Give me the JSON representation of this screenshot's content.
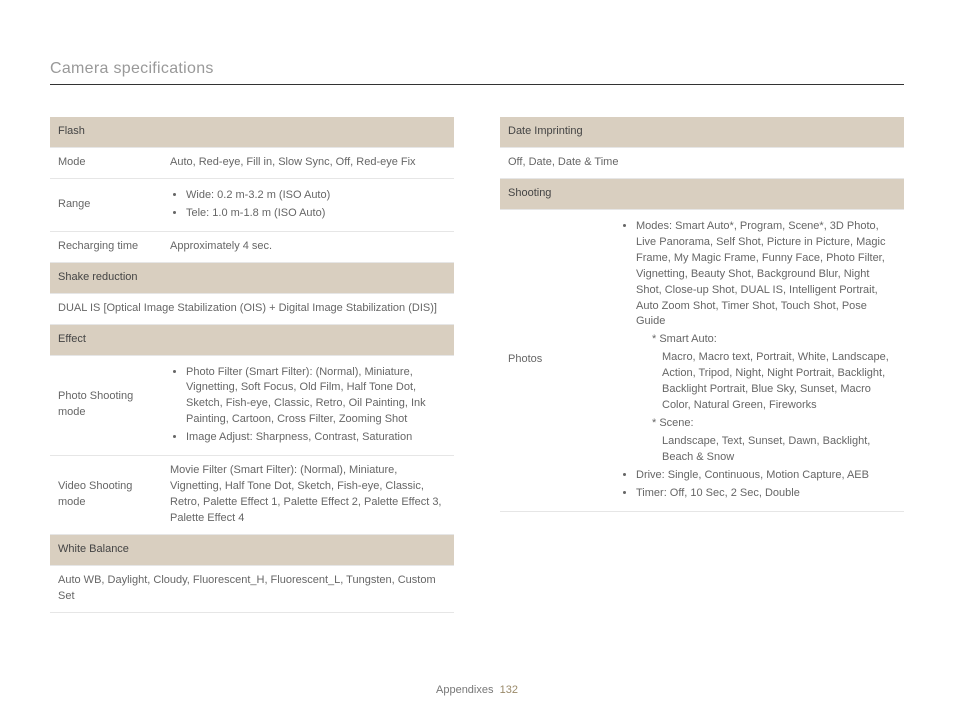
{
  "page_title": "Camera specifications",
  "footer_label": "Appendixes",
  "footer_page": "132",
  "left": {
    "flash": {
      "header": "Flash",
      "mode_label": "Mode",
      "mode_value": "Auto, Red-eye, Fill in, Slow Sync, Off, Red-eye Fix",
      "range_label": "Range",
      "range_items": [
        "Wide: 0.2 m-3.2 m (ISO Auto)",
        "Tele: 1.0 m-1.8 m (ISO Auto)"
      ],
      "recharge_label": "Recharging time",
      "recharge_value": "Approximately 4 sec."
    },
    "shake": {
      "header": "Shake reduction",
      "value": "DUAL IS [Optical Image Stabilization (OIS) + Digital Image Stabilization (DIS)]"
    },
    "effect": {
      "header": "Effect",
      "photo_label": "Photo Shooting mode",
      "photo_items": [
        "Photo Filter (Smart Filter): (Normal), Miniature, Vignetting, Soft Focus, Old Film, Half Tone Dot, Sketch, Fish-eye, Classic, Retro, Oil Painting, Ink Painting, Cartoon, Cross Filter, Zooming Shot",
        "Image Adjust: Sharpness, Contrast, Saturation"
      ],
      "video_label": "Video Shooting mode",
      "video_value": "Movie Filter (Smart Filter): (Normal), Miniature, Vignetting, Half Tone Dot, Sketch, Fish-eye, Classic, Retro, Palette Effect 1, Palette Effect 2, Palette Effect 3, Palette Effect 4"
    },
    "wb": {
      "header": "White Balance",
      "value": "Auto WB, Daylight, Cloudy, Fluorescent_H, Fluorescent_L, Tungsten, Custom Set"
    }
  },
  "right": {
    "date": {
      "header": "Date Imprinting",
      "value": "Off, Date, Date & Time"
    },
    "shooting": {
      "header": "Shooting",
      "photos_label": "Photos",
      "modes_bullet": "Modes: Smart Auto*, Program, Scene*, 3D Photo, Live Panorama, Self Shot, Picture in Picture, Magic Frame, My Magic Frame, Funny Face, Photo Filter, Vignetting, Beauty Shot, Background Blur, Night Shot, Close-up Shot, DUAL IS, Intelligent Portrait, Auto Zoom Shot, Timer Shot, Touch Shot, Pose Guide",
      "smart_auto_label": "* Smart Auto:",
      "smart_auto_value": "Macro, Macro text, Portrait, White, Landscape, Action, Tripod, Night, Night Portrait, Backlight, Backlight Portrait, Blue Sky, Sunset, Macro Color, Natural Green, Fireworks",
      "scene_label": "* Scene:",
      "scene_value": "Landscape, Text, Sunset, Dawn, Backlight, Beach & Snow",
      "drive_bullet": "Drive: Single, Continuous, Motion Capture, AEB",
      "timer_bullet": "Timer: Off, 10 Sec, 2 Sec, Double"
    }
  }
}
